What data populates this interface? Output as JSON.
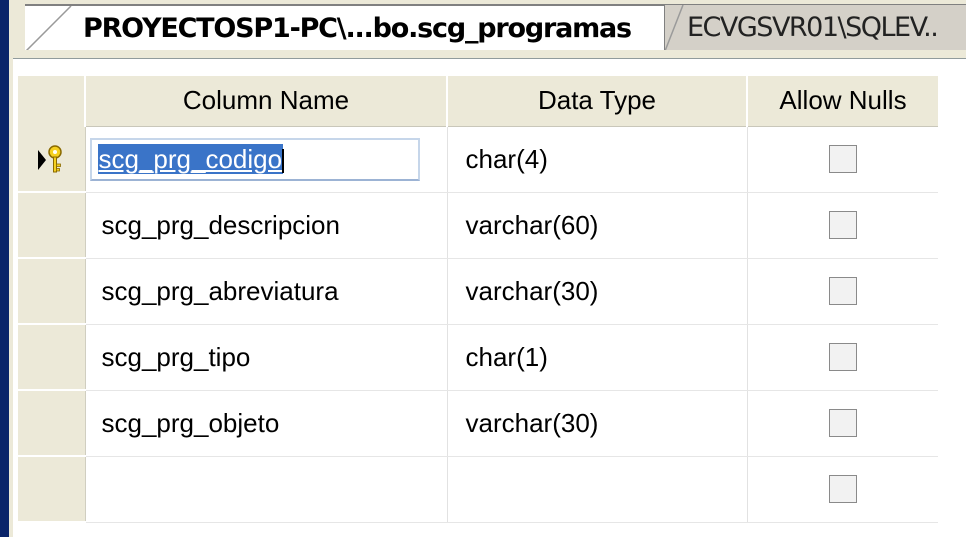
{
  "tabs": [
    {
      "label": "PROYECTOSP1-PC\\...bo.scg_programas",
      "active": true
    },
    {
      "label": "ECVGSVR01\\SQLEV..",
      "active": false
    }
  ],
  "columns": {
    "name": "Column Name",
    "type": "Data Type",
    "nulls": "Allow Nulls"
  },
  "rows": [
    {
      "name": "scg_prg_codigo",
      "type": "char(4)",
      "allow_nulls": false,
      "primary_key": true,
      "editing": true
    },
    {
      "name": "scg_prg_descripcion",
      "type": "varchar(60)",
      "allow_nulls": false
    },
    {
      "name": "scg_prg_abreviatura",
      "type": "varchar(30)",
      "allow_nulls": false
    },
    {
      "name": "scg_prg_tipo",
      "type": "char(1)",
      "allow_nulls": false
    },
    {
      "name": "scg_prg_objeto",
      "type": "varchar(30)",
      "allow_nulls": false
    },
    {
      "name": "",
      "type": "",
      "allow_nulls": false
    }
  ],
  "colors": {
    "selection": "#3a74c8",
    "header_bg": "#ece9d8",
    "frame_blue": "#0a246a"
  },
  "icons": {
    "row_marker": "current-row-arrow-with-primary-key-icon"
  }
}
